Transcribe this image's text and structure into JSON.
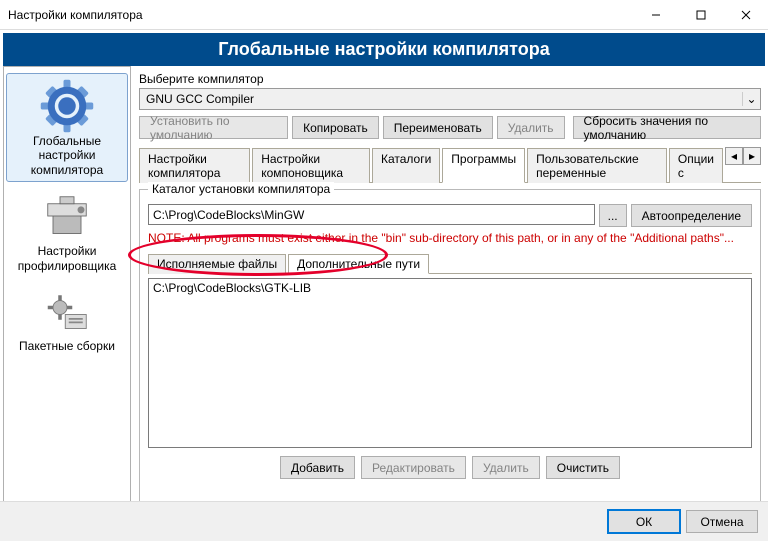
{
  "titlebar": {
    "title": "Настройки компилятора"
  },
  "banner": "Глобальные настройки компилятора",
  "sidebar": {
    "items": [
      {
        "label": "Глобальные настройки компилятора"
      },
      {
        "label": "Настройки профилировщика"
      },
      {
        "label": "Пакетные сборки"
      }
    ]
  },
  "compiler_select": {
    "label": "Выберите компилятор",
    "value": "GNU GCC Compiler"
  },
  "compiler_buttons": {
    "set_default": "Установить по умолчанию",
    "copy": "Копировать",
    "rename": "Переименовать",
    "delete": "Удалить",
    "reset": "Сбросить значения по умолчанию"
  },
  "tabs": {
    "items": [
      "Настройки компилятора",
      "Настройки компоновщика",
      "Каталоги",
      "Программы",
      "Пользовательские переменные",
      "Опции с"
    ],
    "active": 3
  },
  "install_dir_group": {
    "legend": "Каталог установки компилятора",
    "path": "C:\\Prog\\CodeBlocks\\MinGW",
    "browse_dots": "...",
    "autodetect": "Автоопределение",
    "note": "NOTE: All programs must exist either in the \"bin\" sub-directory of this path, or in any of the \"Additional paths\"..."
  },
  "subtabs": {
    "items": [
      "Исполняемые файлы",
      "Дополнительные пути"
    ],
    "active": 1
  },
  "listbox": {
    "items": [
      "C:\\Prog\\CodeBlocks\\GTK-LIB"
    ]
  },
  "list_buttons": {
    "add": "Добавить",
    "edit": "Редактировать",
    "delete": "Удалить",
    "clear": "Очистить"
  },
  "dialog_buttons": {
    "ok": "ОК",
    "cancel": "Отмена"
  }
}
